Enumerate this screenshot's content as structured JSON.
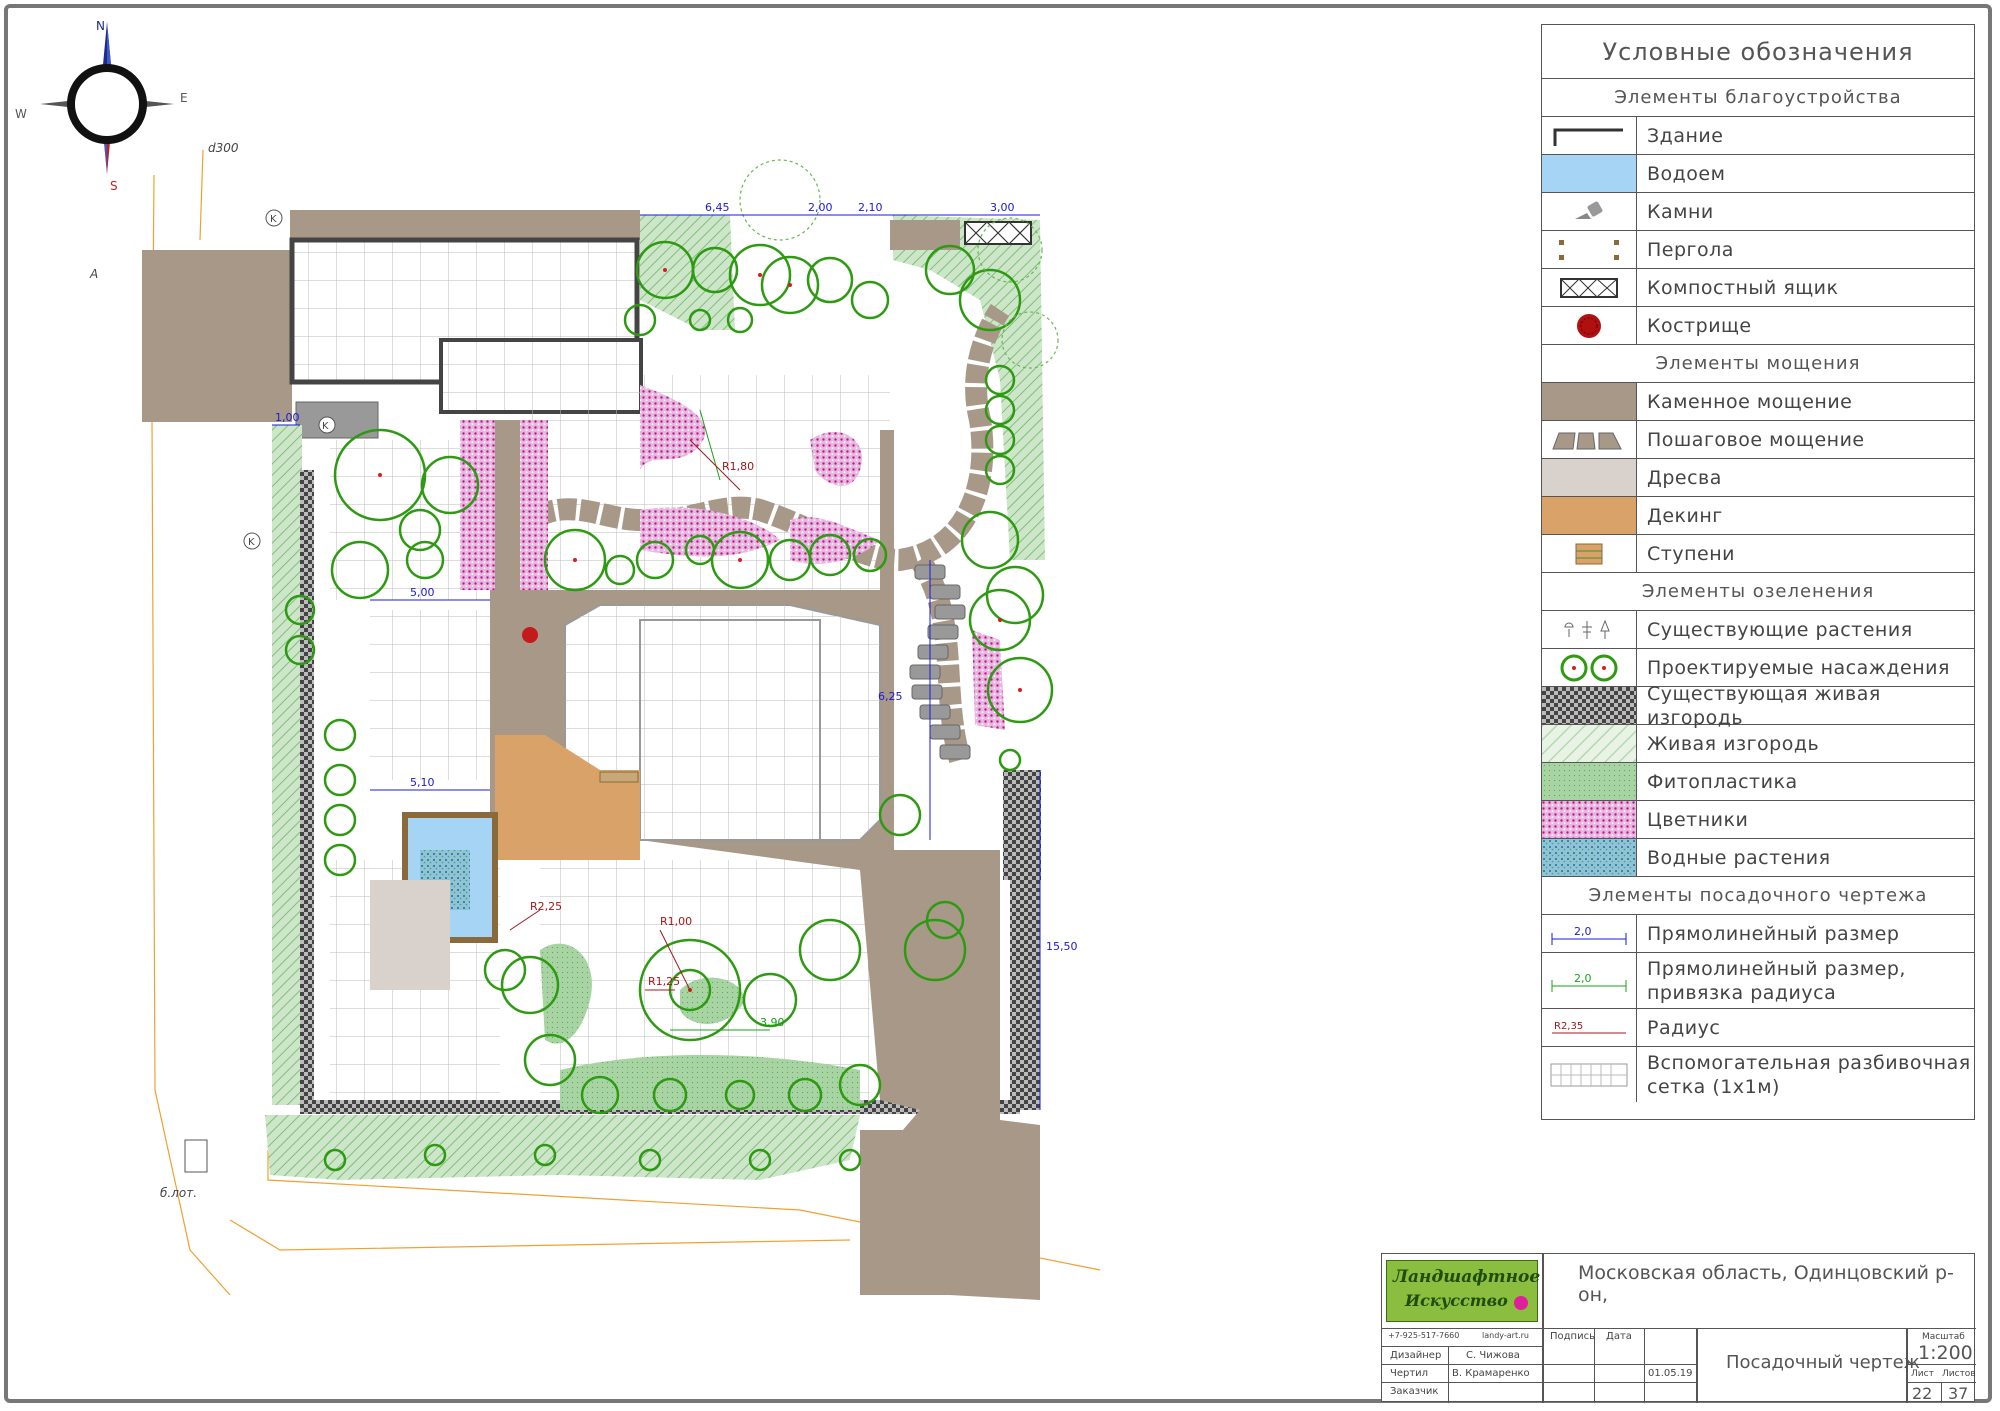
{
  "compass": {
    "n": "N",
    "s": "S",
    "e": "E",
    "w": "W"
  },
  "site_labels": {
    "pipe": "d300",
    "a_mark": "A",
    "k_mark": "K",
    "pole": "б.лот."
  },
  "dims_sample": {
    "top_width": "6,45",
    "top_a": "2,00",
    "top_b": "2,10",
    "top_c": "3,00",
    "left_a": "1,00",
    "right_total": "15,50",
    "deck_w": "5,10",
    "lawn_w": "5,00",
    "radius_a": "R1,80",
    "radius_b": "R1,00",
    "radius_c": "R2,25",
    "radius_d": "R1,25",
    "grid_dim": "3,90",
    "grid_dim2": "6,25"
  },
  "legend": {
    "title": "Условные обозначения",
    "sec1": "Элементы благоустройства",
    "building": "Здание",
    "water": "Водоем",
    "stones": "Камни",
    "pergola": "Пергола",
    "compost": "Компостный ящик",
    "fire": "Кострище",
    "sec2": "Элементы мощения",
    "stone_paving": "Каменное мощение",
    "step_paving": "Пошаговое мощение",
    "bark": "Дресва",
    "decking": "Декинг",
    "steps": "Ступени",
    "sec3": "Элементы озеленения",
    "existing_plants": "Существующие растения",
    "planned_plants": "Проектируемые насаждения",
    "existing_hedge": "Существующая живая изгородь",
    "hedge": "Живая изгородь",
    "topiary": "Фитопластика",
    "flowerbeds": "Цветники",
    "water_plants": "Водные растения",
    "sec4": "Элементы посадочного чертежа",
    "dim_sample": "2,0",
    "linear_dim": "Прямолинейный размер",
    "radius_dim_sample": "2,0",
    "linear_dim_radius": "Прямолинейный размер, привязка радиуса",
    "radius_sample": "R2,35",
    "radius": "Радиус",
    "grid": "Вспомогательная разбивочная сетка (1х1м)"
  },
  "title_block": {
    "logo_line1": "Ландшафтное",
    "logo_line2": "Искусство",
    "phone": "+7-925-517-7660",
    "site": "landy-art.ru",
    "podpis": "Подпись",
    "data_h": "Дата",
    "designer_role": "Дизайнер",
    "designer_name": "С. Чижова",
    "drafter_role": "Чертил",
    "drafter_name": "В. Крамаренко",
    "date": "01.05.19",
    "client_role": "Заказчик",
    "location": "Московская область, Одинцовский р-он,",
    "drawing": "Посадочный чертеж",
    "scale_h": "Масштаб",
    "scale": "1:200",
    "sheet_h": "Лист",
    "sheets_h": "Листов",
    "sheet": "22",
    "sheets": "37"
  },
  "colors": {
    "stone_paving": "#a89888",
    "bark": "#d9d2cc",
    "decking": "#d8a268",
    "water": "#a6d4f4",
    "hedge": "#b9dbb6",
    "flower": "#d98fd0",
    "plant": "#2e9a12",
    "dim_blue": "#1a1ad6",
    "dim_green": "#18a018",
    "dim_red": "#a01818"
  }
}
